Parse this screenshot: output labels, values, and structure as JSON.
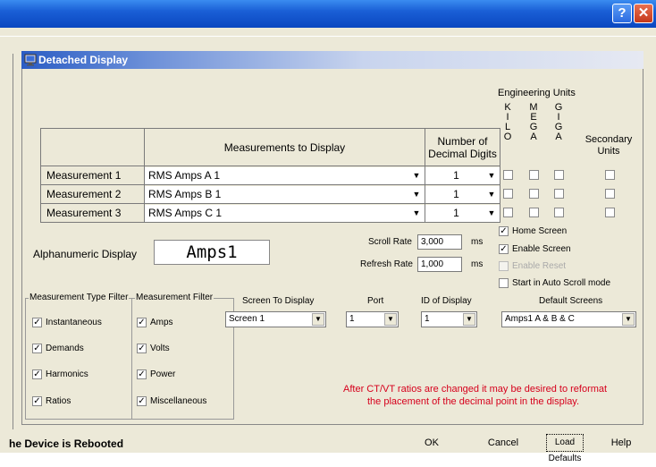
{
  "window": {
    "help_btn": "?",
    "close_btn": "✕"
  },
  "dialog": {
    "title": "Detached Display"
  },
  "engineering_units": {
    "heading": "Engineering Units",
    "col_kilo": [
      "K",
      "I",
      "L",
      "O"
    ],
    "col_mega": [
      "M",
      "E",
      "G",
      "A"
    ],
    "col_giga": [
      "G",
      "I",
      "G",
      "A"
    ],
    "secondary_line1": "Secondary",
    "secondary_line2": "Units"
  },
  "table": {
    "header_measurements": "Measurements to Display",
    "header_decimals_line1": "Number of",
    "header_decimals_line2": "Decimal Digits",
    "rows": [
      {
        "label": "Measurement 1",
        "measurement": "RMS Amps A 1",
        "digits": "1"
      },
      {
        "label": "Measurement 2",
        "measurement": "RMS Amps B 1",
        "digits": "1"
      },
      {
        "label": "Measurement 3",
        "measurement": "RMS Amps C 1",
        "digits": "1"
      }
    ]
  },
  "alpha": {
    "label": "Alphanumeric Display",
    "value": "Amps1"
  },
  "rates": {
    "scroll_label": "Scroll Rate",
    "scroll_value": "3,000",
    "scroll_unit": "ms",
    "refresh_label": "Refresh Rate",
    "refresh_value": "1,000",
    "refresh_unit": "ms"
  },
  "options": {
    "home_screen": "Home Screen",
    "enable_screen": "Enable Screen",
    "enable_reset": "Enable Reset",
    "auto_scroll": "Start in Auto Scroll mode"
  },
  "type_filter": {
    "title": "Measurement Type Filter",
    "items": [
      "Instantaneous",
      "Demands",
      "Harmonics",
      "Ratios"
    ]
  },
  "meas_filter": {
    "title": "Measurement Filter",
    "items": [
      "Amps",
      "Volts",
      "Power",
      "Miscellaneous"
    ]
  },
  "selectors": {
    "screen_label": "Screen To Display",
    "screen_value": "Screen 1",
    "port_label": "Port",
    "port_value": "1",
    "id_label": "ID of Display",
    "id_value": "1",
    "defaults_label": "Default Screens",
    "defaults_value": "Amps1 A & B & C"
  },
  "note": {
    "line1": "After CT/VT ratios are changed it may be desired to reformat",
    "line2": "the placement of the decimal point in the display."
  },
  "buttons": {
    "ok": "OK",
    "cancel": "Cancel",
    "load_defaults": "Load Defaults",
    "help": "Help"
  },
  "status": {
    "text": "he Device is Rebooted"
  },
  "colors": {
    "note_red": "#d6001c",
    "title_blue": "#0a47c0"
  }
}
